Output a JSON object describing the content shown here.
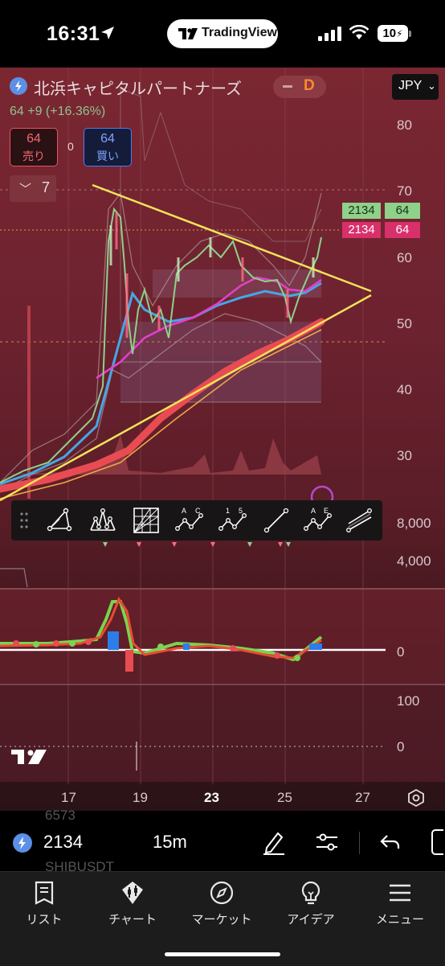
{
  "status_bar": {
    "time": "16:31",
    "pill_text": "TradingView",
    "battery": "10"
  },
  "chart": {
    "symbol_name": "北浜キャピタルパートナーズ",
    "exchange_badge": "D",
    "currency": "JPY",
    "price_change": "64  +9 (+16.36%)",
    "sell_price": "64",
    "sell_label": "売り",
    "buy_price": "64",
    "buy_label": "買い",
    "spread": "0",
    "indicators_count": "7",
    "price_axis": [
      "80",
      "70",
      "60",
      "50",
      "40",
      "30"
    ],
    "volume_axis": [
      "8,000",
      "4,000"
    ],
    "macd_axis": [
      "0"
    ],
    "rsi_axis": [
      "100",
      "0"
    ],
    "time_axis": [
      "17",
      "19",
      "23",
      "25",
      "27"
    ],
    "tags": {
      "green_left": "2134",
      "green_right": "64",
      "red_left": "2134",
      "red_right": "64"
    },
    "colors": {
      "up": "#8fd18a",
      "down": "#ff6b87",
      "triangle": "#f4e25a",
      "ma_red": "#e84c52",
      "ma_blue": "#46a6e8",
      "ma_magenta": "#e040c8",
      "background": "#6d2230"
    }
  },
  "drawing_toolbar": {
    "tools": [
      "triangle-pattern",
      "head-shoulders-pattern",
      "gann-box",
      "abcd-pattern",
      "elliott-wave-15",
      "trend-line",
      "ae-pattern",
      "parallel-channel"
    ],
    "tool_letters": {
      "abcd": [
        "A",
        "C"
      ],
      "elliott": [
        "1",
        "5"
      ],
      "ae": [
        "A",
        "E"
      ]
    }
  },
  "bottom_bar": {
    "ghost_top": "6573",
    "ghost_bottom": "SHIBUSDT",
    "symbol_price": "2134",
    "interval": "15m"
  },
  "tabbar": {
    "items": [
      {
        "label": "リスト",
        "icon": "list-icon"
      },
      {
        "label": "チャート",
        "icon": "chart-icon"
      },
      {
        "label": "マーケット",
        "icon": "compass-icon"
      },
      {
        "label": "アイデア",
        "icon": "lightbulb-icon"
      },
      {
        "label": "メニュー",
        "icon": "menu-icon"
      }
    ]
  }
}
